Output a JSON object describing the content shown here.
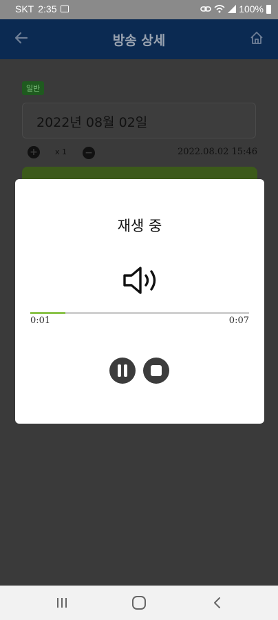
{
  "status_bar": {
    "carrier": "SKT",
    "time": "2:35",
    "battery": "100%",
    "icons": [
      "image-icon",
      "link-icon",
      "wifi-icon",
      "signal-icon",
      "battery-icon"
    ]
  },
  "app_bar": {
    "title": "방송 상세",
    "back_icon": "arrow-left-icon",
    "home_icon": "home-icon",
    "background": "#0b2a52"
  },
  "detail": {
    "badge": "일반",
    "date": "2022년 08월 02일",
    "speed": "x 1",
    "timestamp": "2022.08.02 15:46"
  },
  "player_dialog": {
    "title": "재생 중",
    "current_time": "0:01",
    "total_time": "0:07",
    "progress": 0.16,
    "accent": "#8bc34a",
    "icons": [
      "speaker-icon",
      "pause-icon",
      "stop-icon"
    ]
  },
  "nav_bar": {
    "icons": [
      "recents-icon",
      "home-circle-icon",
      "back-chevron-icon"
    ]
  }
}
